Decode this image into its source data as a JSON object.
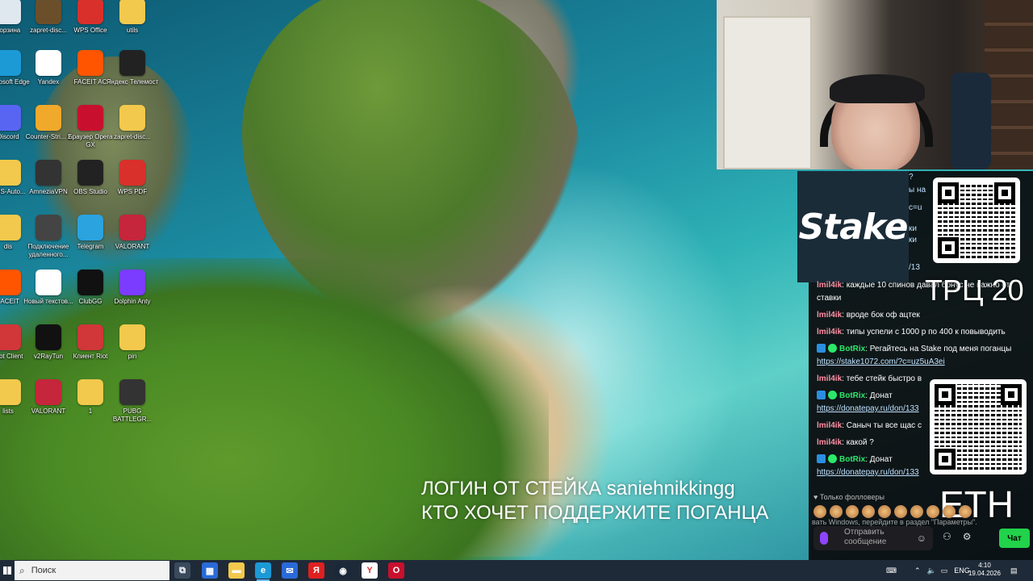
{
  "desktop": {
    "icons": [
      {
        "label": "Корзина",
        "color": "#dfe7ef"
      },
      {
        "label": "zapret-disc...",
        "color": "#6b4f2a"
      },
      {
        "label": "WPS Office",
        "color": "#d9302b"
      },
      {
        "label": "utils",
        "color": "#f2c94c"
      },
      {
        "label": "Microsoft Edge",
        "color": "#1c9ad6"
      },
      {
        "label": "Yandex",
        "color": "#ffffff"
      },
      {
        "label": "FACEIT AC",
        "color": "#ff5500"
      },
      {
        "label": "Яндекс Телемост",
        "color": "#222222"
      },
      {
        "label": "Discord",
        "color": "#5865f2"
      },
      {
        "label": "Counter-Stri... 2",
        "color": "#f1a92c"
      },
      {
        "label": "Браузер Opera GX",
        "color": "#c8102e"
      },
      {
        "label": "zapret-disc...",
        "color": "#f2c94c"
      },
      {
        "label": "KMS-Auto...",
        "color": "#f2c94c"
      },
      {
        "label": "AmneziaVPN",
        "color": "#333333"
      },
      {
        "label": "OBS Studio",
        "color": "#222222"
      },
      {
        "label": "WPS PDF",
        "color": "#d9302b"
      },
      {
        "label": "dis",
        "color": "#f2c94c"
      },
      {
        "label": "Подключение удаленного...",
        "color": "#444444"
      },
      {
        "label": "Telegram",
        "color": "#2aa3df"
      },
      {
        "label": "VALORANT",
        "color": "#c5263b"
      },
      {
        "label": "FACEIT",
        "color": "#ff5500"
      },
      {
        "label": "Новый текстов...",
        "color": "#ffffff"
      },
      {
        "label": "ClubGG",
        "color": "#111111"
      },
      {
        "label": "Dolphin Anty",
        "color": "#7b3cff"
      },
      {
        "label": "Riot Client",
        "color": "#d13639"
      },
      {
        "label": "v2RayTun",
        "color": "#111111"
      },
      {
        "label": "Клиент Riot",
        "color": "#d13639"
      },
      {
        "label": "pin",
        "color": "#f2c94c"
      },
      {
        "label": "lists",
        "color": "#f2c94c"
      },
      {
        "label": "VALORANT",
        "color": "#c5263b"
      },
      {
        "label": "1",
        "color": "#f2c94c"
      },
      {
        "label": "PUBG BATTLEGR...",
        "color": "#333333"
      }
    ]
  },
  "stake": {
    "logo": "Stake"
  },
  "chat": {
    "lines": [
      {
        "type": "clip",
        "text": "?"
      },
      {
        "type": "clip",
        "text": "ы на"
      },
      {
        "type": "clip",
        "text": "c=u"
      },
      {
        "type": "clip",
        "text": "ки"
      },
      {
        "type": "clip",
        "text": "ки"
      },
      {
        "type": "clip",
        "text": "/13"
      }
    ],
    "messages": [
      {
        "user": "lmil4ik",
        "text": "каждые 10 спинов давал бонус не важно от",
        "cont": "ставки"
      },
      {
        "user": "lmil4ik",
        "text": "вроде бок оф ацтек"
      },
      {
        "user": "lmil4ik",
        "text": "типы успели с 1000 р по 400 к повыводить"
      },
      {
        "bot": "BotRix",
        "text": "Регайтесь на Stake под меня поганцы",
        "link": "https://stake1072.com/?c=uz5uA3ei"
      },
      {
        "user": "lmil4ik",
        "text": "тебе стейк быстро в"
      },
      {
        "bot": "BotRix",
        "text": "Донат",
        "link": "https://donatepay.ru/don/133"
      },
      {
        "user": "lmil4ik",
        "text": "Саныч ты все щас с"
      },
      {
        "user": "lmil4ik",
        "text": "какой ?"
      },
      {
        "bot": "BotRix",
        "text": "Донат",
        "link": "https://donatepay.ru/don/133"
      }
    ],
    "followers_only": "Только фолловеры",
    "activate_windows": "вать Windows, перейдите в раздел \"Параметры\".",
    "input_placeholder": "Отправить сообщение",
    "send_label": "Чат"
  },
  "overlay": {
    "trc": "ТРЦ 20",
    "eth": "ETH",
    "line1": "ЛОГИН ОТ СТЕЙКА saniehnikkingg",
    "line2": "КТО ХОЧЕТ ПОДДЕРЖИТЕ ПОГАНЦА"
  },
  "taskbar": {
    "search_placeholder": "Поиск",
    "apps": [
      {
        "name": "task-view",
        "color": "#3a4a5c",
        "glyph": "⧉"
      },
      {
        "name": "store",
        "color": "#2a6ad8",
        "glyph": "▦"
      },
      {
        "name": "explorer",
        "color": "#f2c94c",
        "glyph": "▬"
      },
      {
        "name": "edge",
        "color": "#1c9ad6",
        "glyph": "e"
      },
      {
        "name": "mail",
        "color": "#2a6ad8",
        "glyph": "✉"
      },
      {
        "name": "yandex",
        "color": "#e02020",
        "glyph": "Я"
      },
      {
        "name": "steam",
        "color": "#1b2838",
        "glyph": "◉"
      },
      {
        "name": "yandex-browser",
        "color": "#ffffff",
        "glyph": "Y"
      },
      {
        "name": "opera-gx",
        "color": "#c8102e",
        "glyph": "O"
      }
    ],
    "lang": "ENG",
    "time": "4:10",
    "date": "19.04.2026"
  }
}
